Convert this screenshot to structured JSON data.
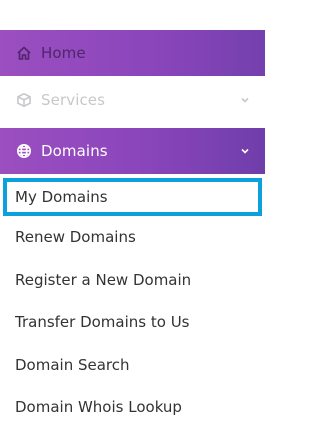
{
  "nav": {
    "home": {
      "label": "Home",
      "icon": "home-icon"
    },
    "services": {
      "label": "Services",
      "icon": "box-icon"
    },
    "domains": {
      "label": "Domains",
      "icon": "globe-icon"
    }
  },
  "domains_menu": {
    "items": [
      {
        "label": "My Domains",
        "active": true
      },
      {
        "label": "Renew Domains"
      },
      {
        "label": "Register a New Domain"
      },
      {
        "label": "Transfer Domains to Us"
      },
      {
        "label": "Domain Search"
      },
      {
        "label": "Domain Whois Lookup"
      }
    ]
  },
  "colors": {
    "gradient_start": "#9b4fc0",
    "gradient_end": "#6f3eaa",
    "active_border": "#0ca0dd"
  }
}
